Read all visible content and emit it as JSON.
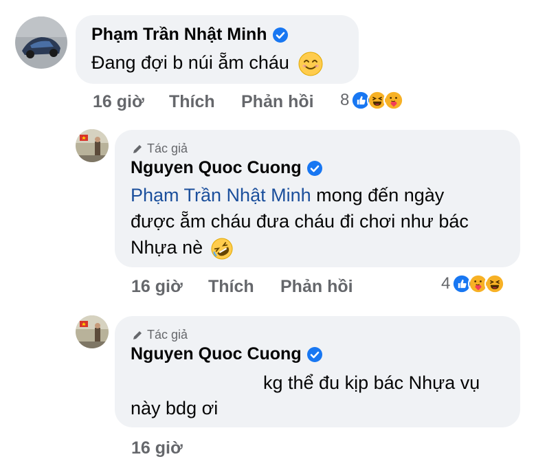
{
  "comments": [
    {
      "author": "Phạm Trần Nhật Minh",
      "text": "Đang đợi b núi ẵm cháu",
      "time": "16 giờ",
      "like": "Thích",
      "reply": "Phản hồi",
      "reaction_count": "8",
      "reactions": [
        "like-icon",
        "haha-icon",
        "care-icon"
      ]
    },
    {
      "author_tag": "Tác giả",
      "author": "Nguyen Quoc Cuong",
      "mention": "Phạm Trần Nhật Minh",
      "text_line1": " mong đến ngày",
      "text_line2": "được ẵm cháu đưa cháu đi chơi như bác",
      "text_line3": "Nhựa nè",
      "time": "16 giờ",
      "like": "Thích",
      "reply": "Phản hồi",
      "reaction_count": "4",
      "reactions": [
        "like-icon",
        "care-icon",
        "haha-icon"
      ]
    },
    {
      "author_tag": "Tác giả",
      "author": "Nguyen Quoc Cuong",
      "text_line1": "kg thể đu kịp bác Nhựa vụ",
      "text_line2": "này bdg ơi",
      "time": "16 giờ"
    }
  ],
  "colors": {
    "bubble": "#f0f2f5",
    "meta_text": "#65676b",
    "mention": "#1b4f9c",
    "verified": "#1877f2",
    "like": "#1877f2",
    "haha": "#f7b125"
  }
}
